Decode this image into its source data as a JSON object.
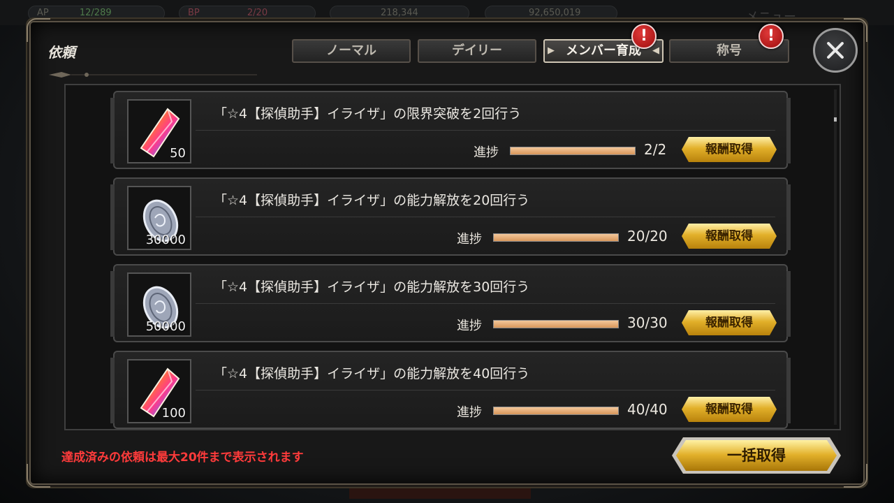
{
  "background": {
    "chips": [
      {
        "label": "AP",
        "value": "12/289"
      },
      {
        "label": "BP",
        "value": "2/20"
      },
      {
        "label": "",
        "value": "218,344"
      },
      {
        "label": "",
        "value": "92,650,019"
      }
    ],
    "menu_label": "メニュー"
  },
  "panel": {
    "title": "依頼",
    "tabs": [
      {
        "label": "ノーマル",
        "active": false,
        "alert": false
      },
      {
        "label": "デイリー",
        "active": false,
        "alert": false
      },
      {
        "label": "メンバー育成",
        "active": true,
        "alert": true
      },
      {
        "label": "称号",
        "active": false,
        "alert": true
      }
    ],
    "alert_symbol": "!"
  },
  "requests": [
    {
      "text": "「☆4【探偵助手】イライザ」の限界突破を2回行う",
      "reward_icon": "rainbow-crystal",
      "reward_qty": "50",
      "progress_label": "進捗",
      "progress_value": "2/2",
      "progress": 1.0,
      "button_label": "報酬取得"
    },
    {
      "text": "「☆4【探偵助手】イライザ」の能力解放を20回行う",
      "reward_icon": "silver-coin",
      "reward_qty": "30000",
      "progress_label": "進捗",
      "progress_value": "20/20",
      "progress": 1.0,
      "button_label": "報酬取得"
    },
    {
      "text": "「☆4【探偵助手】イライザ」の能力解放を30回行う",
      "reward_icon": "silver-coin",
      "reward_qty": "50000",
      "progress_label": "進捗",
      "progress_value": "30/30",
      "progress": 1.0,
      "button_label": "報酬取得"
    },
    {
      "text": "「☆4【探偵助手】イライザ」の能力解放を40回行う",
      "reward_icon": "rainbow-crystal",
      "reward_qty": "100",
      "progress_label": "進捗",
      "progress_value": "40/40",
      "progress": 1.0,
      "button_label": "報酬取得"
    }
  ],
  "footer": {
    "note": "達成済みの依頼は最大20件まで表示されます",
    "claim_all_label": "一括取得"
  },
  "colors": {
    "accent_gold": "#e2b02a",
    "note_red": "#ff3b3b",
    "progress_fill": "#f3c79a"
  }
}
